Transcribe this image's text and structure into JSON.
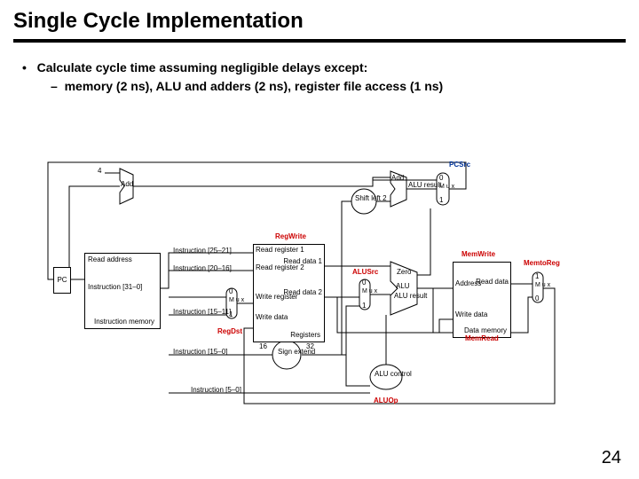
{
  "title": "Single Cycle Implementation",
  "bullet1": "Calculate cycle time assuming negligible delays except:",
  "bullet2": "memory (2 ns), ALU and adders (2 ns), register file access (1 ns)",
  "page": "24",
  "sig": {
    "pcsrc": "PCSrc",
    "regwrite": "RegWrite",
    "alusrc": "ALUSrc",
    "memwrite": "MemWrite",
    "memtoreg": "MemtoReg",
    "memread": "MemRead",
    "regdst": "RegDst",
    "aluop": "ALUOp"
  },
  "labels": {
    "pc": "PC",
    "four": "4",
    "add1": "Add",
    "add2": "Add",
    "addres": "ALU\nresult",
    "shl2": "Shift\nleft 2",
    "readaddr": "Read\naddress",
    "instr_rng": "Instruction\n[31–0]",
    "imem": "Instruction\nmemory",
    "i25_21": "Instruction [25–21]",
    "i20_16": "Instruction [20–16]",
    "i15_11": "Instruction [15–11]",
    "i15_0": "Instruction [15–0]",
    "i5_0": "Instruction [5–0]",
    "readreg1": "Read\nregister 1",
    "readreg2": "Read\nregister 2",
    "writereg": "Write\nregister",
    "writedata": "Write\ndata",
    "readdata1": "Read\ndata 1",
    "readdata2": "Read\ndata 2",
    "registers": "Registers",
    "signext": "Sign\nextend",
    "sixteen": "16",
    "thirtytwo": "32",
    "zero": "Zero",
    "alu": "ALU",
    "alures": "ALU\nresult",
    "aluctrl": "ALU\ncontrol",
    "addr": "Address",
    "wdata": "Write\ndata",
    "rdata": "Read\ndata",
    "dmem": "Data\nmemory",
    "mux": "M\nu\nx",
    "m0": "0",
    "m1": "1"
  }
}
